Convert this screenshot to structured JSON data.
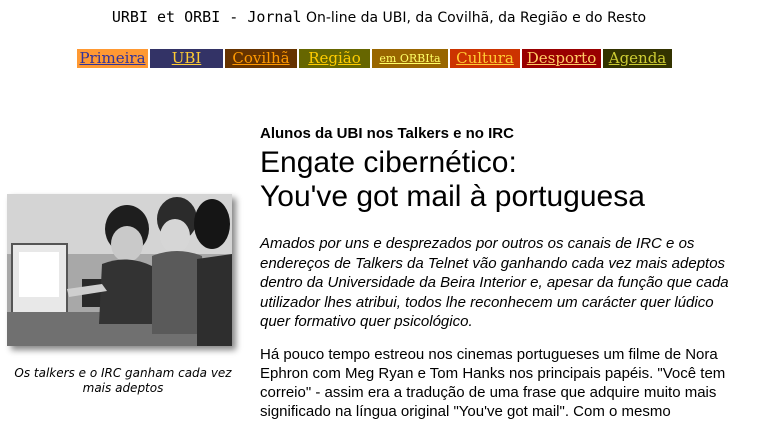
{
  "masthead": {
    "brand": "URBI et ORBI - Jornal",
    "tagline": "On-line da UBI, da Covilhã, da Região e do Resto"
  },
  "nav": [
    {
      "label": "Primeira",
      "bg": "#ff9933",
      "fg": "#333399",
      "w": 71
    },
    {
      "label": "UBI",
      "bg": "#333366",
      "fg": "#ffcc33",
      "w": 73
    },
    {
      "label": "Covilhã",
      "bg": "#663300",
      "fg": "#ff9900",
      "w": 72
    },
    {
      "label": "Região",
      "bg": "#666600",
      "fg": "#ffcc00",
      "w": 71
    },
    {
      "label": "em ORBIta",
      "bg": "#996600",
      "fg": "#ffff66",
      "w": 76,
      "small": true
    },
    {
      "label": "Cultura",
      "bg": "#cc3300",
      "fg": "#ffcc33",
      "w": 70
    },
    {
      "label": "Desporto",
      "bg": "#990000",
      "fg": "#ffcc66",
      "w": 79
    },
    {
      "label": "Agenda",
      "bg": "#333300",
      "fg": "#cccc33",
      "w": 69
    }
  ],
  "photo": {
    "caption": "Os talkers e o IRC ganham cada vez mais adeptos"
  },
  "article": {
    "kicker": "Alunos da UBI nos Talkers e no IRC",
    "headline_line1": "Engate cibernético:",
    "headline_line2": "You've got mail à portuguesa",
    "lead": "Amados por uns e desprezados por outros os canais de IRC e os endereços de Talkers da Telnet vão ganhando cada vez mais adeptos dentro da Universidade da Beira Interior e, apesar da função que cada utilizador lhes atribui, todos lhe reconhecem um carácter quer lúdico quer formativo quer psicológico.",
    "body": "Há pouco tempo estreou nos cinemas portugueses um filme de Nora Ephron com Meg Ryan e Tom Hanks nos principais papéis. \"Você tem correio\" -  assim era a tradução de uma frase que adquire muito mais significado na língua original \"You've got mail\". Com o mesmo"
  }
}
